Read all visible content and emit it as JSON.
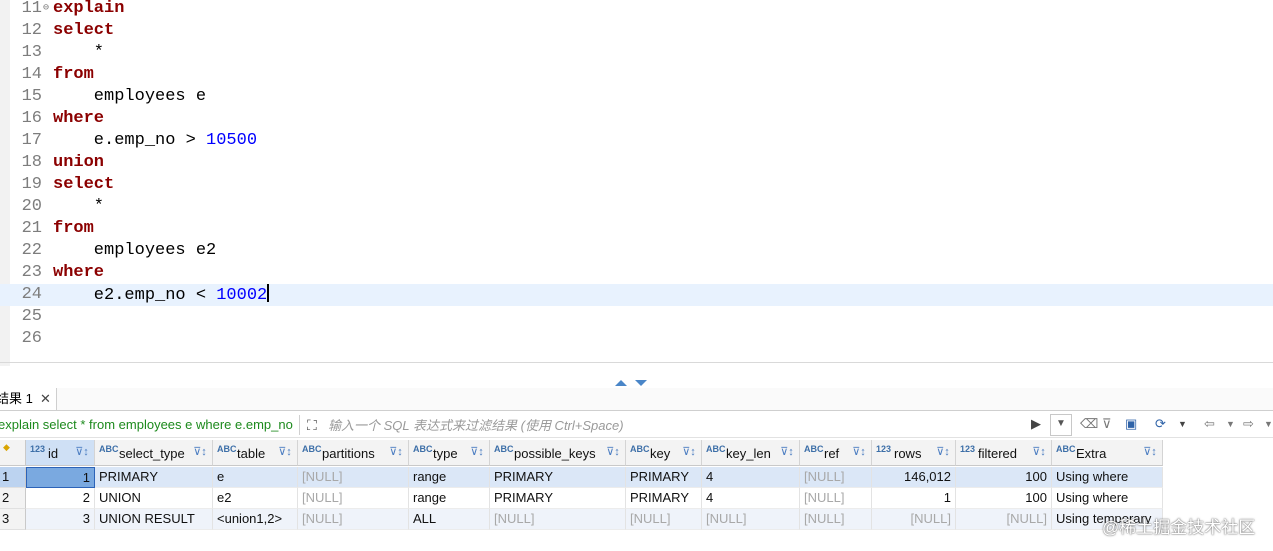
{
  "editor": {
    "lines": [
      {
        "n": "11",
        "parts": [
          {
            "t": "explain",
            "k": "kw"
          }
        ],
        "fold": true
      },
      {
        "n": "12",
        "parts": [
          {
            "t": "select",
            "k": "kw"
          }
        ]
      },
      {
        "n": "13",
        "parts": [
          {
            "t": "    *",
            "k": ""
          }
        ]
      },
      {
        "n": "14",
        "parts": [
          {
            "t": "from",
            "k": "kw"
          }
        ]
      },
      {
        "n": "15",
        "parts": [
          {
            "t": "    employees e",
            "k": ""
          }
        ]
      },
      {
        "n": "16",
        "parts": [
          {
            "t": "where",
            "k": "kw"
          }
        ]
      },
      {
        "n": "17",
        "parts": [
          {
            "t": "    e.emp_no > ",
            "k": ""
          },
          {
            "t": "10500",
            "k": "num"
          }
        ]
      },
      {
        "n": "18",
        "parts": [
          {
            "t": "union",
            "k": "kw"
          }
        ]
      },
      {
        "n": "19",
        "parts": [
          {
            "t": "select",
            "k": "kw"
          }
        ]
      },
      {
        "n": "20",
        "parts": [
          {
            "t": "    *",
            "k": ""
          }
        ]
      },
      {
        "n": "21",
        "parts": [
          {
            "t": "from",
            "k": "kw"
          }
        ]
      },
      {
        "n": "22",
        "parts": [
          {
            "t": "    employees e2",
            "k": ""
          }
        ]
      },
      {
        "n": "23",
        "parts": [
          {
            "t": "where",
            "k": "kw"
          }
        ]
      },
      {
        "n": "24",
        "parts": [
          {
            "t": "    e2.emp_no < ",
            "k": ""
          },
          {
            "t": "10002",
            "k": "num"
          }
        ],
        "current": true,
        "caret": true
      },
      {
        "n": "25",
        "parts": []
      },
      {
        "n": "26",
        "parts": []
      }
    ]
  },
  "results": {
    "tab_label": "结果 1",
    "tab_close": "✕",
    "query_text": "explain select * from employees e where e.emp_no",
    "filter_placeholder": "输入一个 SQL 表达式来过滤结果 (使用 Ctrl+Space)",
    "columns": [
      {
        "name": "id",
        "type": "123"
      },
      {
        "name": "select_type",
        "type": "ABC"
      },
      {
        "name": "table",
        "type": "ABC"
      },
      {
        "name": "partitions",
        "type": "ABC"
      },
      {
        "name": "type",
        "type": "ABC"
      },
      {
        "name": "possible_keys",
        "type": "ABC"
      },
      {
        "name": "key",
        "type": "ABC"
      },
      {
        "name": "key_len",
        "type": "ABC"
      },
      {
        "name": "ref",
        "type": "ABC"
      },
      {
        "name": "rows",
        "type": "123"
      },
      {
        "name": "filtered",
        "type": "123"
      },
      {
        "name": "Extra",
        "type": "ABC"
      }
    ],
    "rows": [
      {
        "rownum": "1",
        "cells": [
          "1",
          "PRIMARY",
          "e",
          "[NULL]",
          "range",
          "PRIMARY",
          "PRIMARY",
          "4",
          "[NULL]",
          "146,012",
          "100",
          "Using where"
        ]
      },
      {
        "rownum": "2",
        "cells": [
          "2",
          "UNION",
          "e2",
          "[NULL]",
          "range",
          "PRIMARY",
          "PRIMARY",
          "4",
          "[NULL]",
          "1",
          "100",
          "Using where"
        ]
      },
      {
        "rownum": "3",
        "cells": [
          "3",
          "UNION RESULT",
          "<union1,2>",
          "[NULL]",
          "ALL",
          "[NULL]",
          "[NULL]",
          "[NULL]",
          "[NULL]",
          "[NULL]",
          "[NULL]",
          "Using temporary"
        ]
      }
    ]
  },
  "watermark": "@稀土掘金技术社区"
}
